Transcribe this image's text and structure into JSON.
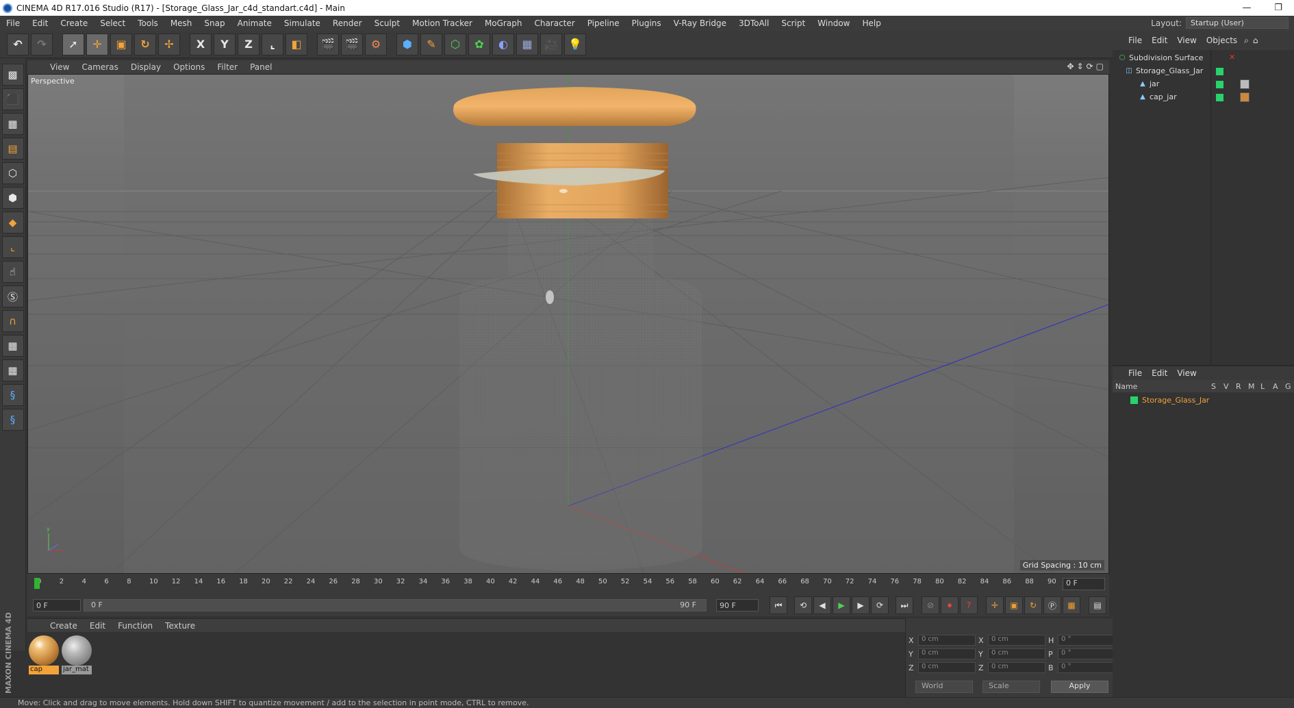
{
  "window": {
    "title": "CINEMA 4D R17.016 Studio (R17) - [Storage_Glass_Jar_c4d_standart.c4d] - Main",
    "minimize": "—",
    "restore": "❐"
  },
  "menubar": {
    "items": [
      "File",
      "Edit",
      "Create",
      "Select",
      "Tools",
      "Mesh",
      "Snap",
      "Animate",
      "Simulate",
      "Render",
      "Sculpt",
      "Motion Tracker",
      "MoGraph",
      "Character",
      "Pipeline",
      "Plugins",
      "V-Ray Bridge",
      "3DToAll",
      "Script",
      "Window",
      "Help"
    ],
    "layout_label": "Layout:",
    "layout_value": "Startup (User)"
  },
  "toolbar": {
    "axis_x": "X",
    "axis_y": "Y",
    "axis_z": "Z"
  },
  "viewport": {
    "menu": [
      "View",
      "Cameras",
      "Display",
      "Options",
      "Filter",
      "Panel"
    ],
    "label": "Perspective",
    "grid_spacing": "Grid Spacing : 10 cm"
  },
  "timeline": {
    "ticks": [
      "0",
      "2",
      "4",
      "6",
      "8",
      "10",
      "12",
      "14",
      "16",
      "18",
      "20",
      "22",
      "24",
      "26",
      "28",
      "30",
      "32",
      "34",
      "36",
      "38",
      "40",
      "42",
      "44",
      "46",
      "48",
      "50",
      "52",
      "54",
      "56",
      "58",
      "60",
      "62",
      "64",
      "66",
      "68",
      "70",
      "72",
      "74",
      "76",
      "78",
      "80",
      "82",
      "84",
      "86",
      "88",
      "90"
    ],
    "current_frame": "0 F",
    "start_field": "0 F",
    "slider_start": "0 F",
    "slider_end": "90 F",
    "end_field": "90 F"
  },
  "materials": {
    "menu": [
      "Create",
      "Edit",
      "Function",
      "Texture"
    ],
    "items": [
      {
        "name": "cap",
        "selected": true
      },
      {
        "name": "jar_mat",
        "selected": false
      }
    ]
  },
  "coords": {
    "pos_x": "0 cm",
    "pos_y": "0 cm",
    "pos_z": "0 cm",
    "size_x": "0 cm",
    "size_y": "0 cm",
    "size_z": "0 cm",
    "rot_h": "0 °",
    "rot_p": "0 °",
    "rot_b": "0 °",
    "mode": "World",
    "scale": "Scale",
    "apply": "Apply"
  },
  "objects": {
    "menu": [
      "File",
      "Edit",
      "View",
      "Objects"
    ],
    "items": [
      {
        "name": "Subdivision Surface"
      },
      {
        "name": "Storage_Glass_Jar"
      },
      {
        "name": "jar"
      },
      {
        "name": "cap_jar"
      }
    ]
  },
  "layers": {
    "menu": [
      "File",
      "Edit",
      "View"
    ],
    "header": {
      "name": "Name",
      "s": "S",
      "v": "V",
      "r": "R",
      "m": "M",
      "l": "L",
      "a": "A",
      "g": "G"
    },
    "items": [
      {
        "name": "Storage_Glass_Jar",
        "color": "#27d36c"
      }
    ]
  },
  "status": {
    "text": "Move: Click and drag to move elements. Hold down SHIFT to quantize movement / add to the selection in point mode, CTRL to remove."
  }
}
